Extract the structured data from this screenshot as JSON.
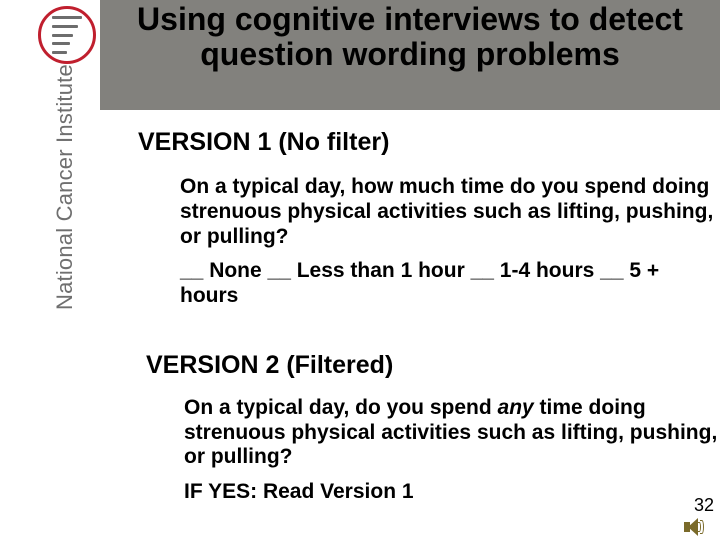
{
  "sidebar": {
    "org_name": "National Cancer Institute",
    "logo_name": "nci-logo"
  },
  "title": "Using cognitive interviews to detect question wording problems",
  "version1": {
    "header": "VERSION 1 (No filter)",
    "question": "On a typical day, how much time do you spend doing strenuous physical activities such as lifting, pushing, or pulling?",
    "options_line": "__ None  __ Less than 1 hour __ 1-4 hours  __ 5 + hours"
  },
  "version2": {
    "header": "VERSION 2 (Filtered)",
    "question_before": "On a typical day, do you spend ",
    "question_italic": "any",
    "question_after": " time doing strenuous physical activities such as lifting, pushing, or pulling?",
    "if_yes": "IF YES:  Read Version 1"
  },
  "page_number": "32",
  "audio_icon": "speaker-icon"
}
